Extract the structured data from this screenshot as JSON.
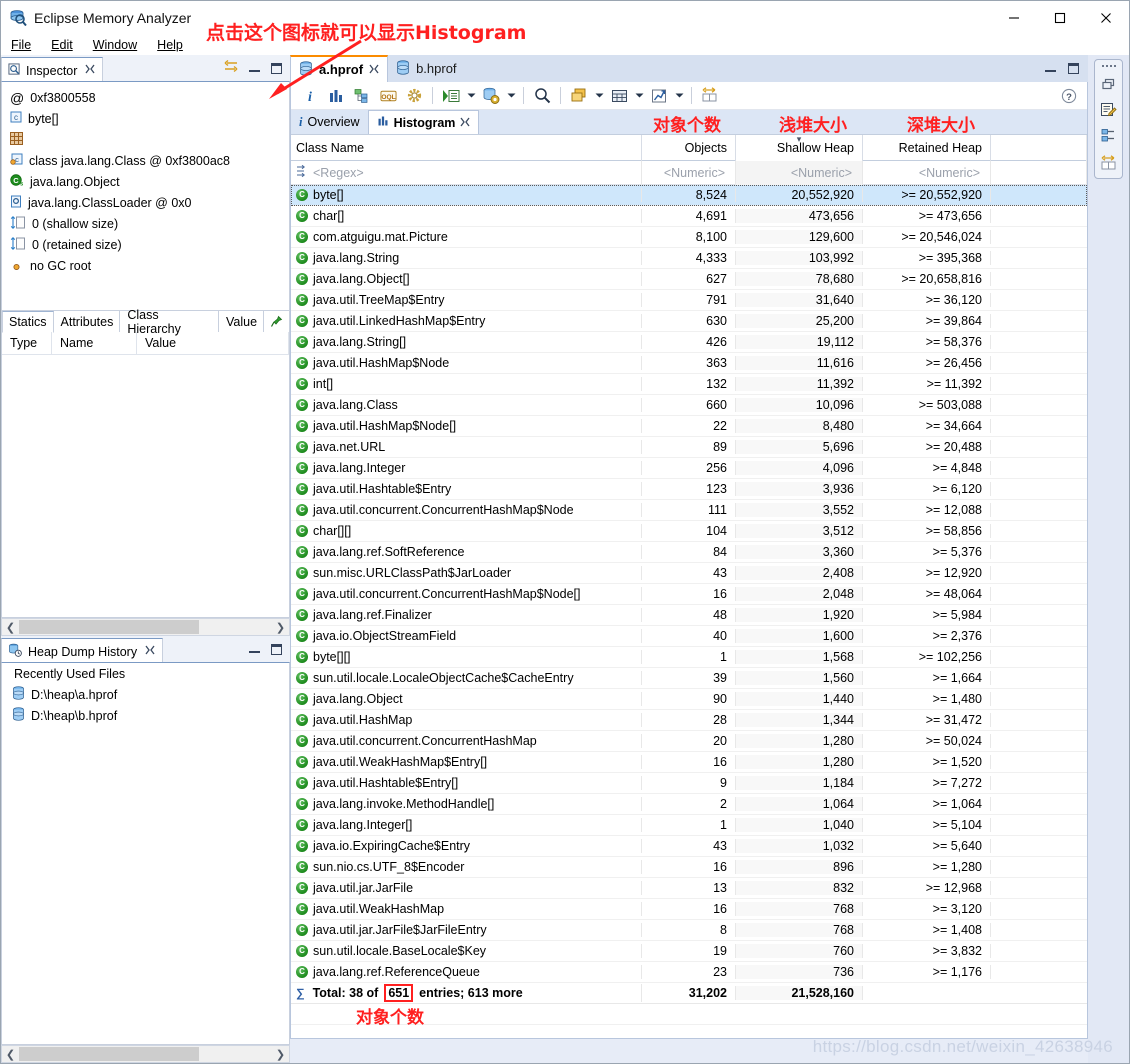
{
  "window": {
    "title": "Eclipse Memory Analyzer",
    "icon": "memory-analyzer-icon",
    "minimize": "—",
    "maximize": "☐",
    "close": "✕"
  },
  "menubar": {
    "items": [
      "File",
      "Edit",
      "Window",
      "Help"
    ]
  },
  "annotations": {
    "toolbar_hint": "点击这个图标就可以显示Histogram",
    "objects_label": "对象个数",
    "shallow_label": "浅堆大小",
    "retained_label": "深堆大小",
    "total_objects_label": "对象个数"
  },
  "inspector": {
    "tab_label": "Inspector",
    "tab_close": "✕",
    "tool_icon": "link-editor-icon",
    "minimize": "minimize-icon",
    "maximize": "maximize-icon",
    "rows": [
      {
        "icon": "address-icon",
        "text": "0xf3800558"
      },
      {
        "icon": "class-icon",
        "text": "byte[]"
      },
      {
        "icon": "grid-icon",
        "text": ""
      },
      {
        "icon": "class-object-icon",
        "text": "class java.lang.Class @ 0xf3800ac8"
      },
      {
        "icon": "superclass-icon",
        "text": "java.lang.Object"
      },
      {
        "icon": "classloader-icon",
        "text": "java.lang.ClassLoader @ 0x0"
      },
      {
        "icon": "shallow-size-icon",
        "text": "0 (shallow size)"
      },
      {
        "icon": "retained-size-icon",
        "text": "0 (retained size)"
      },
      {
        "icon": "gc-root-icon",
        "text": "no GC root"
      }
    ],
    "tabs": [
      "Statics",
      "Attributes",
      "Class Hierarchy",
      "Value"
    ],
    "active_tab": "Statics",
    "pin_icon": "pin-icon",
    "columns": [
      "Type",
      "Name",
      "Value"
    ]
  },
  "heap_dump_history": {
    "tab_label": "Heap Dump History",
    "tab_close": "✕",
    "icon": "heap-history-icon",
    "section_title": "Recently Used Files",
    "files": [
      "D:\\heap\\a.hprof",
      "D:\\heap\\b.hprof"
    ]
  },
  "editor": {
    "tabs": [
      {
        "label": "a.hprof",
        "active": true,
        "close": "✕",
        "icon": "hprof-icon"
      },
      {
        "label": "b.hprof",
        "active": false,
        "close": "",
        "icon": "hprof-icon"
      }
    ],
    "minimize": "minimize-icon",
    "maximize": "maximize-icon",
    "toolbar": [
      {
        "name": "overview-info-icon",
        "glyph": "i"
      },
      {
        "name": "histogram-icon",
        "glyph": "histogram"
      },
      {
        "name": "dominator-tree-icon",
        "glyph": "dominator"
      },
      {
        "name": "oql-icon",
        "glyph": "OQL"
      },
      {
        "name": "calculate-retained-size-icon",
        "glyph": "gear"
      },
      {
        "name": "run-expert-system-icon",
        "glyph": "run"
      },
      {
        "name": "query-browser-icon",
        "glyph": "queries"
      },
      {
        "name": "find-icon",
        "glyph": "search"
      },
      {
        "name": "group-by-icon",
        "glyph": "group"
      },
      {
        "name": "export-table-icon",
        "glyph": "table"
      },
      {
        "name": "open-chart-icon",
        "glyph": "chart"
      },
      {
        "name": "compare-icon",
        "glyph": "compare"
      }
    ],
    "help_icon": "help-icon",
    "inner_tabs": [
      {
        "label": "Overview",
        "icon": "info-icon",
        "active": false
      },
      {
        "label": "Histogram",
        "icon": "histogram-icon",
        "active": true,
        "close": "✕"
      }
    ]
  },
  "table": {
    "columns": [
      "Class Name",
      "Objects",
      "Shallow Heap",
      "Retained Heap"
    ],
    "sorted_column": "Shallow Heap",
    "filters": [
      "<Regex>",
      "<Numeric>",
      "<Numeric>",
      "<Numeric>"
    ],
    "filter_icon": "filter-icon",
    "row_icon": "class-icon",
    "rows": [
      {
        "name": "byte[]",
        "objects": "8,524",
        "shallow": "20,552,920",
        "retained": ">= 20,552,920",
        "selected": true
      },
      {
        "name": "char[]",
        "objects": "4,691",
        "shallow": "473,656",
        "retained": ">= 473,656"
      },
      {
        "name": "com.atguigu.mat.Picture",
        "objects": "8,100",
        "shallow": "129,600",
        "retained": ">= 20,546,024"
      },
      {
        "name": "java.lang.String",
        "objects": "4,333",
        "shallow": "103,992",
        "retained": ">= 395,368"
      },
      {
        "name": "java.lang.Object[]",
        "objects": "627",
        "shallow": "78,680",
        "retained": ">= 20,658,816"
      },
      {
        "name": "java.util.TreeMap$Entry",
        "objects": "791",
        "shallow": "31,640",
        "retained": ">= 36,120"
      },
      {
        "name": "java.util.LinkedHashMap$Entry",
        "objects": "630",
        "shallow": "25,200",
        "retained": ">= 39,864"
      },
      {
        "name": "java.lang.String[]",
        "objects": "426",
        "shallow": "19,112",
        "retained": ">= 58,376"
      },
      {
        "name": "java.util.HashMap$Node",
        "objects": "363",
        "shallow": "11,616",
        "retained": ">= 26,456"
      },
      {
        "name": "int[]",
        "objects": "132",
        "shallow": "11,392",
        "retained": ">= 11,392"
      },
      {
        "name": "java.lang.Class",
        "objects": "660",
        "shallow": "10,096",
        "retained": ">= 503,088"
      },
      {
        "name": "java.util.HashMap$Node[]",
        "objects": "22",
        "shallow": "8,480",
        "retained": ">= 34,664"
      },
      {
        "name": "java.net.URL",
        "objects": "89",
        "shallow": "5,696",
        "retained": ">= 20,488"
      },
      {
        "name": "java.lang.Integer",
        "objects": "256",
        "shallow": "4,096",
        "retained": ">= 4,848"
      },
      {
        "name": "java.util.Hashtable$Entry",
        "objects": "123",
        "shallow": "3,936",
        "retained": ">= 6,120"
      },
      {
        "name": "java.util.concurrent.ConcurrentHashMap$Node",
        "objects": "111",
        "shallow": "3,552",
        "retained": ">= 12,088"
      },
      {
        "name": "char[][]",
        "objects": "104",
        "shallow": "3,512",
        "retained": ">= 58,856"
      },
      {
        "name": "java.lang.ref.SoftReference",
        "objects": "84",
        "shallow": "3,360",
        "retained": ">= 5,376"
      },
      {
        "name": "sun.misc.URLClassPath$JarLoader",
        "objects": "43",
        "shallow": "2,408",
        "retained": ">= 12,920"
      },
      {
        "name": "java.util.concurrent.ConcurrentHashMap$Node[]",
        "objects": "16",
        "shallow": "2,048",
        "retained": ">= 48,064"
      },
      {
        "name": "java.lang.ref.Finalizer",
        "objects": "48",
        "shallow": "1,920",
        "retained": ">= 5,984"
      },
      {
        "name": "java.io.ObjectStreamField",
        "objects": "40",
        "shallow": "1,600",
        "retained": ">= 2,376"
      },
      {
        "name": "byte[][]",
        "objects": "1",
        "shallow": "1,568",
        "retained": ">= 102,256"
      },
      {
        "name": "sun.util.locale.LocaleObjectCache$CacheEntry",
        "objects": "39",
        "shallow": "1,560",
        "retained": ">= 1,664"
      },
      {
        "name": "java.lang.Object",
        "objects": "90",
        "shallow": "1,440",
        "retained": ">= 1,480"
      },
      {
        "name": "java.util.HashMap",
        "objects": "28",
        "shallow": "1,344",
        "retained": ">= 31,472"
      },
      {
        "name": "java.util.concurrent.ConcurrentHashMap",
        "objects": "20",
        "shallow": "1,280",
        "retained": ">= 50,024"
      },
      {
        "name": "java.util.WeakHashMap$Entry[]",
        "objects": "16",
        "shallow": "1,280",
        "retained": ">= 1,520"
      },
      {
        "name": "java.util.Hashtable$Entry[]",
        "objects": "9",
        "shallow": "1,184",
        "retained": ">= 7,272"
      },
      {
        "name": "java.lang.invoke.MethodHandle[]",
        "objects": "2",
        "shallow": "1,064",
        "retained": ">= 1,064"
      },
      {
        "name": "java.lang.Integer[]",
        "objects": "1",
        "shallow": "1,040",
        "retained": ">= 5,104"
      },
      {
        "name": "java.io.ExpiringCache$Entry",
        "objects": "43",
        "shallow": "1,032",
        "retained": ">= 5,640"
      },
      {
        "name": "sun.nio.cs.UTF_8$Encoder",
        "objects": "16",
        "shallow": "896",
        "retained": ">= 1,280"
      },
      {
        "name": "java.util.jar.JarFile",
        "objects": "13",
        "shallow": "832",
        "retained": ">= 12,968"
      },
      {
        "name": "java.util.WeakHashMap",
        "objects": "16",
        "shallow": "768",
        "retained": ">= 3,120"
      },
      {
        "name": "java.util.jar.JarFile$JarFileEntry",
        "objects": "8",
        "shallow": "768",
        "retained": ">= 1,408"
      },
      {
        "name": "sun.util.locale.BaseLocale$Key",
        "objects": "19",
        "shallow": "760",
        "retained": ">= 3,832"
      },
      {
        "name": "java.lang.ref.ReferenceQueue",
        "objects": "23",
        "shallow": "736",
        "retained": ">= 1,176"
      }
    ],
    "total": {
      "icon": "sum-icon",
      "prefix": "Total: 38 of ",
      "highlight": "651",
      "suffix": " entries; 613 more",
      "objects": "31,202",
      "shallow": "21,528,160",
      "retained": ""
    }
  },
  "right_bar": {
    "items": [
      {
        "name": "restore-icon"
      },
      {
        "name": "inspector-icon"
      },
      {
        "name": "dominator-tree-icon"
      },
      {
        "name": "compare-icon"
      }
    ]
  },
  "watermark": "https://blog.csdn.net/weixin_42638946"
}
